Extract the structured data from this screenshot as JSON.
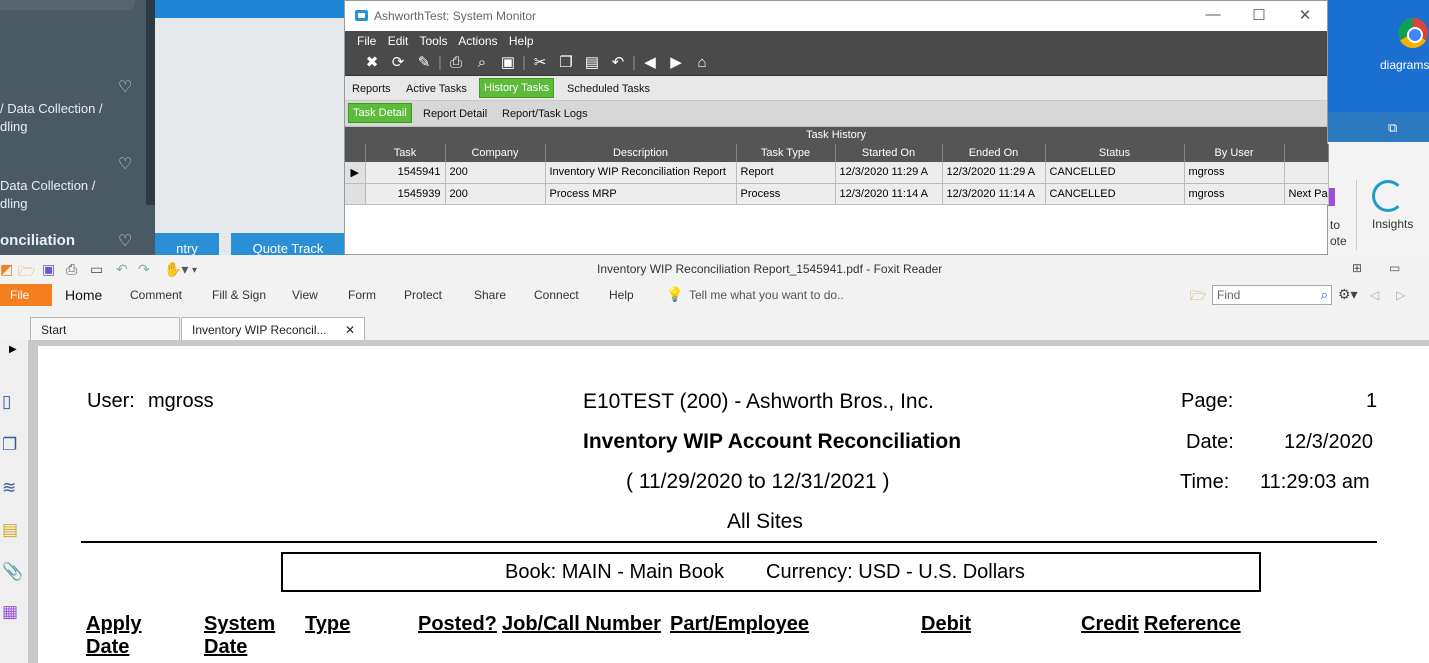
{
  "background_browser": {
    "lines": [
      "/ Data Collection /",
      "dling",
      "Data Collection /",
      "dling",
      "onciliation"
    ],
    "buttons": [
      "ntry",
      "Quote Track"
    ]
  },
  "desktop": {
    "icon_label": "diagrams",
    "ribbon_partial_labels": [
      "to",
      "ote"
    ],
    "insights_label": "Insights"
  },
  "system_monitor": {
    "title": "AshworthTest: System Monitor",
    "menu": [
      "File",
      "Edit",
      "Tools",
      "Actions",
      "Help"
    ],
    "tabs_row1": [
      "Reports",
      "Active Tasks",
      "History Tasks",
      "Scheduled Tasks"
    ],
    "active_tab_row1": "History Tasks",
    "tabs_row2": [
      "Task Detail",
      "Report Detail",
      "Report/Task Logs"
    ],
    "active_tab_row2": "Task Detail",
    "grid_title": "Task History",
    "columns": [
      "Task",
      "Company",
      "Description",
      "Task Type",
      "Started On",
      "Ended On",
      "Status",
      "By User",
      ""
    ],
    "rows": [
      {
        "task": "1545941",
        "company": "200",
        "description": "Inventory WIP Reconciliation Report",
        "task_type": "Report",
        "started_on": "12/3/2020 11:29 A",
        "ended_on": "12/3/2020 11:29 A",
        "status": "CANCELLED",
        "by_user": "mgross",
        "extra": ""
      },
      {
        "task": "1545939",
        "company": "200",
        "description": "Process MRP",
        "task_type": "Process",
        "started_on": "12/3/2020 11:14 A",
        "ended_on": "12/3/2020 11:14 A",
        "status": "CANCELLED",
        "by_user": "mgross",
        "extra": "Next Pa"
      }
    ]
  },
  "foxit": {
    "title": "Inventory WIP Reconciliation Report_1545941.pdf - Foxit Reader",
    "file_label": "File",
    "menu": [
      "Home",
      "Comment",
      "Fill & Sign",
      "View",
      "Form",
      "Protect",
      "Share",
      "Connect",
      "Help"
    ],
    "tell_me": "Tell me what you want to do..",
    "find_placeholder": "Find",
    "tabs": [
      "Start",
      "Inventory WIP Reconcil..."
    ],
    "report": {
      "user_label": "User:",
      "user_value": "mgross",
      "company": "E10TEST (200) - Ashworth Bros., Inc.",
      "report_title": "Inventory WIP Account Reconciliation",
      "date_range": "( 11/29/2020 to 12/31/2021 )",
      "sites": "All Sites",
      "page_label": "Page:",
      "page_value": "1",
      "date_label": "Date:",
      "date_value": "12/3/2020",
      "time_label": "Time:",
      "time_value": "11:29:03 am",
      "book": "Book: MAIN - Main Book",
      "currency": "Currency: USD - U.S. Dollars",
      "columns": [
        "Apply Date",
        "System Date",
        "Type",
        "Posted?",
        "Job/Call Number",
        "Part/Employee",
        "Debit",
        "Credit",
        "Reference"
      ]
    }
  }
}
